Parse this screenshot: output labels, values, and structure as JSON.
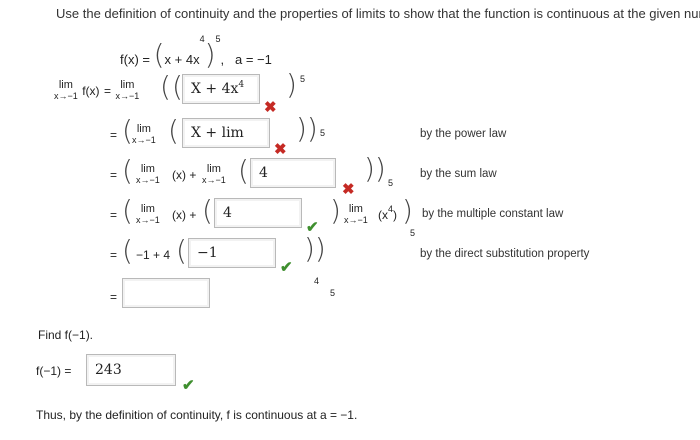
{
  "question": "Use the definition of continuity and the properties of limits to show that the function is continuous at the given number",
  "function_lhs": "f(x) = ",
  "function_inner": "x + 4x",
  "function_inner_exp": "4",
  "function_outer_exp": "5",
  "point": "a = −1",
  "lim_word": "lim",
  "lim_sub": "x→−1",
  "fx": "f(x)",
  "eq": "=",
  "x_paren": "(x)",
  "plus": "+",
  "x4_paren": "(x",
  "x4_exp": "4",
  "x4_close": ")",
  "exp5": "5",
  "exp4": "4",
  "row1_box": "X + 4x",
  "row1_box_exp": "4",
  "row2_box": "X + lim",
  "row3_box": "4",
  "row4_box": "4",
  "row5_prefix": "−1 + 4",
  "row5_box": "−1",
  "row6_box": "",
  "reasons": {
    "power": "by the power law",
    "sum": "by the sum law",
    "multiple": "by the multiple constant law",
    "direct": "by the direct substitution property"
  },
  "find_label": "Find f(−1).",
  "f_at_label": "f(−1) =",
  "f_at_value": "243",
  "conclusion": "Thus, by the definition of continuity, f is continuous at a = −1.",
  "icons": {
    "incorrect": "✖",
    "correct": "✔"
  },
  "colors": {
    "incorrect": "#c52a24",
    "correct": "#3f8f2f"
  }
}
